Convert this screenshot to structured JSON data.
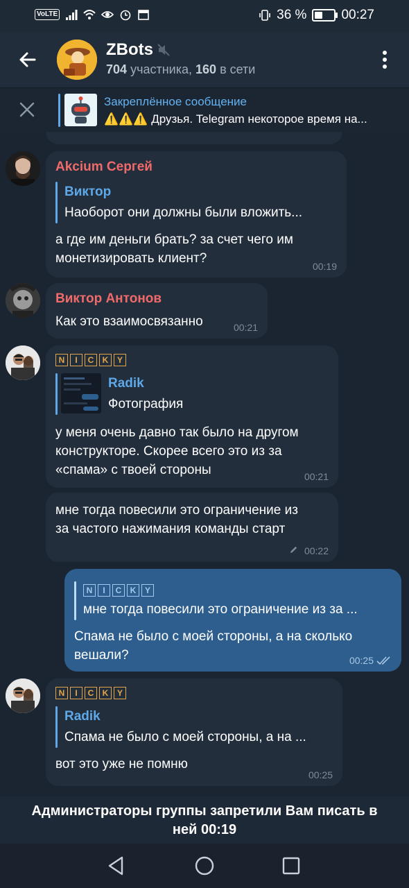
{
  "status_bar": {
    "volte": "VoLTE",
    "battery_pct": "36 %",
    "battery_level": 0.36,
    "time": "00:27"
  },
  "header": {
    "title": "ZBots",
    "members_count": "704",
    "members_label": "участника,",
    "online_count": "160",
    "online_label": "в сети"
  },
  "pinned": {
    "title": "Закреплённое сообщение",
    "text": "⚠️⚠️⚠️ Друзья. Telegram некоторое время на..."
  },
  "messages": [
    {
      "sender": "Akcium Сергей",
      "reply_name": "Виктор",
      "reply_text": "Наоборот они должны были вложить...",
      "text": "а где им деньги брать? за счет чего им\nмонетизировать клиент?",
      "time": "00:19"
    },
    {
      "sender": "Виктор Антонов",
      "text": "Как это взаимосвязанно",
      "time": "00:21"
    },
    {
      "sender_letters": [
        "N",
        "I",
        "C",
        "K",
        "Y"
      ],
      "reply_name": "Radik",
      "reply_text": "Фотография",
      "text": "у меня очень давно так было на другом\nконструкторе. Скорее всего это из за\n«спама» с твоей стороны",
      "time": "00:21"
    },
    {
      "text": "мне тогда повесили это ограничение из\nза частого нажимания команды старт",
      "time": "00:22"
    },
    {
      "reply_letters": [
        "N",
        "I",
        "C",
        "K",
        "Y"
      ],
      "reply_text": "мне тогда повесили это ограничение из за ...",
      "text": "Спама не было с моей стороны, а на сколько\nвешали?",
      "time": "00:25"
    },
    {
      "sender_letters": [
        "N",
        "I",
        "C",
        "K",
        "Y"
      ],
      "reply_name": "Radik",
      "reply_text": "Спама не было с моей стороны, а на ...",
      "text": "вот это уже не помню",
      "time": "00:25"
    }
  ],
  "restriction": {
    "line1": "Администраторы группы запретили Вам писать в",
    "line2": "ней 00:19"
  },
  "colors": {
    "background": "#1b2431",
    "header": "#212d3b",
    "bubble_in": "#222e3c",
    "bubble_out": "#2e5e8e",
    "accent": "#5fa8e8",
    "sender_red": "#f06a6a",
    "nicky_orange": "#e5a64a"
  }
}
